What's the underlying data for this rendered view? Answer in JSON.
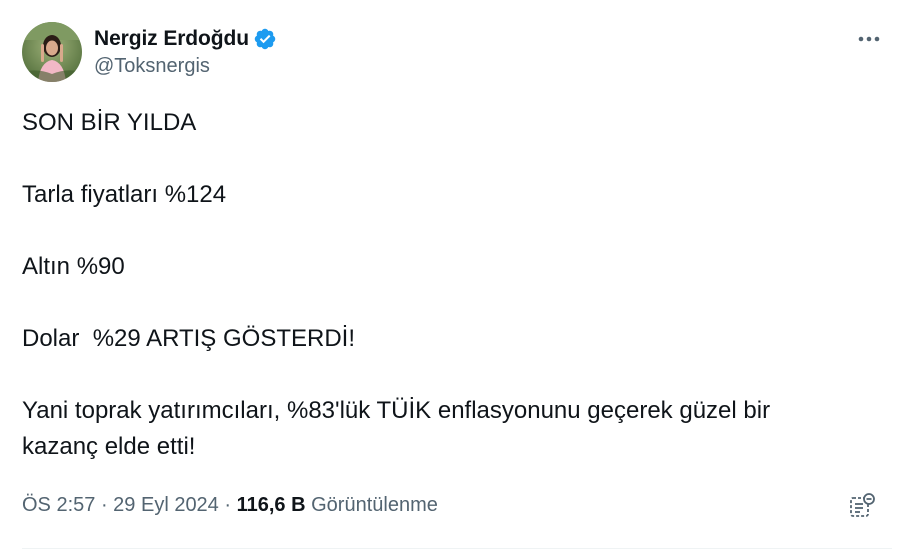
{
  "author": {
    "display_name": "Nergiz Erdoğdu",
    "handle": "@Toksnergis",
    "verified": true
  },
  "tweet": {
    "lines": [
      "SON BİR YILDA",
      "",
      "Tarla fiyatları %124",
      "",
      "Altın %90",
      "",
      "Dolar  %29 ARTIŞ GÖSTERDİ!",
      "",
      "Yani toprak yatırımcıları, %83'lük TÜİK enflasyonunu geçerek güzel bir",
      "kazanç elde etti!"
    ]
  },
  "meta": {
    "time": "ÖS 2:57",
    "separator": " · ",
    "date": "29 Eyl 2024",
    "views_count": "116,6 B",
    "views_label": "Görüntülenme"
  },
  "colors": {
    "text": "#0f1419",
    "secondary": "#536471",
    "verified_blue": "#1d9bf0",
    "divider": "#eff3f4"
  },
  "icons": {
    "verified": "verified-badge-icon",
    "more": "more-options-icon",
    "analytics": "analytics-icon"
  }
}
